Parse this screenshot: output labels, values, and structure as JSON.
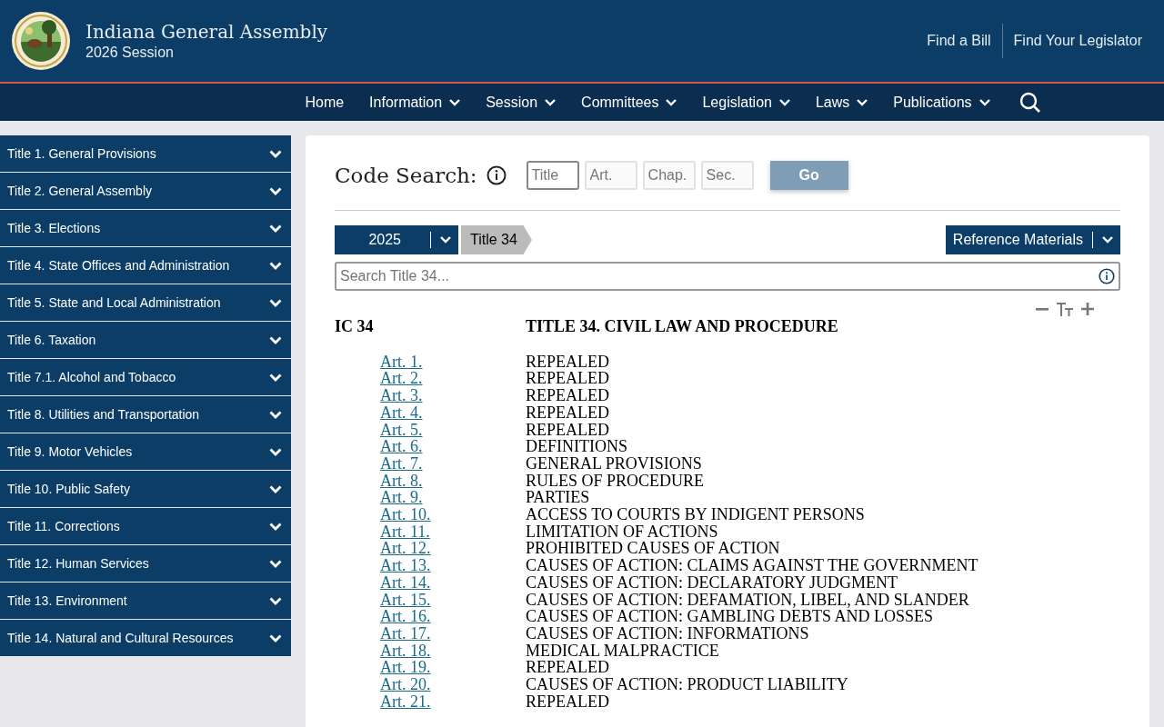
{
  "header": {
    "title": "Indiana General Assembly",
    "subtitle": "2026 Session",
    "links": [
      "Find a Bill",
      "Find Your Legislator"
    ]
  },
  "nav": [
    {
      "label": "Home",
      "dropdown": false
    },
    {
      "label": "Information",
      "dropdown": true
    },
    {
      "label": "Session",
      "dropdown": true
    },
    {
      "label": "Committees",
      "dropdown": true
    },
    {
      "label": "Legislation",
      "dropdown": true
    },
    {
      "label": "Laws",
      "dropdown": true
    },
    {
      "label": "Publications",
      "dropdown": true
    }
  ],
  "sidebar": {
    "items": [
      {
        "label": "Title 1. General Provisions",
        "expanded": false
      },
      {
        "label": "Title 2. General Assembly",
        "expanded": false
      },
      {
        "label": "Title 3. Elections",
        "expanded": false
      },
      {
        "label": "Title 4. State Offices and Administration",
        "expanded": false
      },
      {
        "label": "Title 5. State and Local Administration",
        "expanded": false
      },
      {
        "label": "Title 6. Taxation",
        "expanded": false
      },
      {
        "label": "Title 7.1. Alcohol and Tobacco",
        "expanded": false
      },
      {
        "label": "Title 8. Utilities and Transportation",
        "expanded": false
      },
      {
        "label": "Title 9. Motor Vehicles",
        "expanded": false
      },
      {
        "label": "Title 10. Public Safety",
        "expanded": false
      },
      {
        "label": "Title 11. Corrections",
        "expanded": false
      },
      {
        "label": "Title 12. Human Services",
        "expanded": false
      },
      {
        "label": "Title 13. Environment",
        "expanded": false
      },
      {
        "label": "Title 14. Natural and Cultural Resources",
        "expanded": false
      }
    ]
  },
  "code_search": {
    "label": "Code Search:",
    "fields": [
      {
        "placeholder": "Title",
        "focused": true
      },
      {
        "placeholder": "Art.",
        "focused": false
      },
      {
        "placeholder": "Chap.",
        "focused": false
      },
      {
        "placeholder": "Sec.",
        "focused": false
      }
    ],
    "button": "Go"
  },
  "year_select": "2025",
  "breadcrumb": "Title 34",
  "reference_menu": "Reference Materials",
  "title_search": {
    "placeholder": "Search Title 34..."
  },
  "document": {
    "code": "IC 34",
    "heading": "TITLE 34. CIVIL LAW AND PROCEDURE",
    "articles": [
      {
        "link": "Art. 1.",
        "name": "REPEALED"
      },
      {
        "link": "Art. 2.",
        "name": "REPEALED"
      },
      {
        "link": "Art. 3.",
        "name": "REPEALED"
      },
      {
        "link": "Art. 4.",
        "name": "REPEALED"
      },
      {
        "link": "Art. 5.",
        "name": "REPEALED"
      },
      {
        "link": "Art. 6.",
        "name": "DEFINITIONS"
      },
      {
        "link": "Art. 7.",
        "name": "GENERAL PROVISIONS"
      },
      {
        "link": "Art. 8.",
        "name": "RULES OF PROCEDURE"
      },
      {
        "link": "Art. 9.",
        "name": "PARTIES"
      },
      {
        "link": "Art. 10.",
        "name": "ACCESS TO COURTS BY INDIGENT PERSONS"
      },
      {
        "link": "Art. 11.",
        "name": "LIMITATION OF ACTIONS"
      },
      {
        "link": "Art. 12.",
        "name": "PROHIBITED CAUSES OF ACTION"
      },
      {
        "link": "Art. 13.",
        "name": "CAUSES OF ACTION: CLAIMS AGAINST THE GOVERNMENT"
      },
      {
        "link": "Art. 14.",
        "name": "CAUSES OF ACTION: DECLARATORY JUDGMENT"
      },
      {
        "link": "Art. 15.",
        "name": "CAUSES OF ACTION: DEFAMATION, LIBEL, AND SLANDER"
      },
      {
        "link": "Art. 16.",
        "name": "CAUSES OF ACTION: GAMBLING DEBTS AND LOSSES"
      },
      {
        "link": "Art. 17.",
        "name": "CAUSES OF ACTION: INFORMATIONS"
      },
      {
        "link": "Art. 18.",
        "name": "MEDICAL MALPRACTICE"
      },
      {
        "link": "Art. 19.",
        "name": "REPEALED"
      },
      {
        "link": "Art. 20.",
        "name": "CAUSES OF ACTION: PRODUCT LIABILITY"
      },
      {
        "link": "Art. 21.",
        "name": "REPEALED"
      }
    ]
  }
}
